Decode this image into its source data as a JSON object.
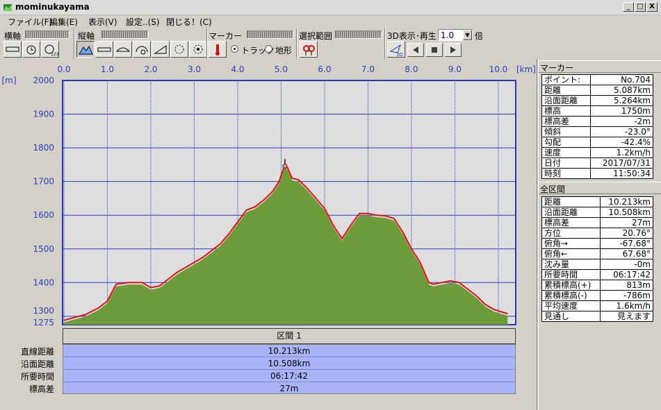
{
  "window": {
    "title": "mominukayama",
    "buttons": [
      "_",
      "□",
      "X"
    ]
  },
  "menu": [
    {
      "label": "ファイル(F)"
    },
    {
      "label": "編集(E)"
    },
    {
      "label": "表示(V)"
    },
    {
      "label": "設定..(S)"
    },
    {
      "label": "閉じる！(C)"
    }
  ],
  "toolbar": {
    "horizontal_label": "横軸",
    "vertical_label": "縦軸",
    "marker_label": "マーカー",
    "track_label": "トラック",
    "terrain_label": "地形",
    "selection_label": "選択範囲",
    "playback_label": "3D表示･再生",
    "speed_value": "1.0",
    "speed_unit": "倍",
    "btn_3d": "3D",
    "btn_123": "123"
  },
  "chart_data": {
    "type": "area",
    "x_unit": "[km]",
    "y_unit": "[m]",
    "x_ticks": [
      "0.0",
      "1.0",
      "2.0",
      "3.0",
      "4.0",
      "5.0",
      "6.0",
      "7.0",
      "8.0",
      "9.0",
      "10.0"
    ],
    "y_ticks": [
      "2000",
      "1900",
      "1800",
      "1700",
      "1600",
      "1500",
      "1400",
      "1300",
      "1275"
    ],
    "xlim": [
      0,
      10.213
    ],
    "ylim": [
      1275,
      2000
    ],
    "x": [
      0,
      0.2,
      0.5,
      0.8,
      1.0,
      1.1,
      1.2,
      1.5,
      1.8,
      2.0,
      2.2,
      2.4,
      2.6,
      2.8,
      3.0,
      3.2,
      3.4,
      3.6,
      3.8,
      4.0,
      4.2,
      4.4,
      4.6,
      4.8,
      4.95,
      5.087,
      5.15,
      5.25,
      5.4,
      5.6,
      5.8,
      6.0,
      6.2,
      6.4,
      6.6,
      6.8,
      7.0,
      7.2,
      7.4,
      7.6,
      7.8,
      8.0,
      8.2,
      8.4,
      8.5,
      8.7,
      8.9,
      9.1,
      9.3,
      9.5,
      9.7,
      9.9,
      10.1,
      10.213
    ],
    "elevation": [
      1288,
      1295,
      1305,
      1325,
      1345,
      1370,
      1395,
      1400,
      1400,
      1385,
      1390,
      1410,
      1430,
      1445,
      1460,
      1475,
      1495,
      1515,
      1545,
      1580,
      1615,
      1625,
      1645,
      1670,
      1700,
      1750,
      1740,
      1710,
      1705,
      1680,
      1650,
      1620,
      1570,
      1530,
      1570,
      1605,
      1605,
      1600,
      1598,
      1590,
      1550,
      1500,
      1460,
      1400,
      1395,
      1400,
      1405,
      1400,
      1380,
      1360,
      1335,
      1320,
      1312,
      1308
    ],
    "marker": {
      "point": "No.704",
      "x": 5.087,
      "y": 1750
    },
    "colors": {
      "fill": "#6e9c3a",
      "line": "#e01010",
      "plot_bg": "#dedede",
      "grid": "#2438c8"
    }
  },
  "segment": {
    "label": "区間 1"
  },
  "stats": [
    {
      "label": "直線距離",
      "value": "10.213km"
    },
    {
      "label": "沿面距離",
      "value": "10.508km"
    },
    {
      "label": "所要時間",
      "value": "06:17:42"
    },
    {
      "label": "標高差",
      "value": "27m"
    }
  ],
  "marker_panel": {
    "title": "マーカー",
    "rows": [
      {
        "k": "ポイント:",
        "v": "No.704"
      },
      {
        "k": "距離",
        "v": "5.087km"
      },
      {
        "k": "沿面距離",
        "v": "5.264km"
      },
      {
        "k": "標高",
        "v": "1750m"
      },
      {
        "k": "標高差",
        "v": "-2m"
      },
      {
        "k": "傾斜",
        "v": "-23.0°"
      },
      {
        "k": "勾配",
        "v": "-42.4%"
      },
      {
        "k": "速度",
        "v": "1.2km/h"
      },
      {
        "k": "日付",
        "v": "2017/07/31"
      },
      {
        "k": "時刻",
        "v": "11:50:34"
      }
    ]
  },
  "total_panel": {
    "title": "全区間",
    "rows": [
      {
        "k": "距離",
        "v": "10.213km"
      },
      {
        "k": "沿面距離",
        "v": "10.508km"
      },
      {
        "k": "標高差",
        "v": "27m"
      },
      {
        "k": "方位",
        "v": "20.76°"
      },
      {
        "k": "俯角→",
        "v": "-67.68°"
      },
      {
        "k": "俯角←",
        "v": "67.68°"
      },
      {
        "k": "沈み量",
        "v": "-0m"
      },
      {
        "k": "所要時間",
        "v": "06:17:42"
      },
      {
        "k": "累積標高(+)",
        "v": "813m"
      },
      {
        "k": "累積標高(-)",
        "v": "-786m"
      },
      {
        "k": "平均速度",
        "v": "1.6km/h"
      },
      {
        "k": "見通し",
        "v": "見えます"
      }
    ]
  }
}
